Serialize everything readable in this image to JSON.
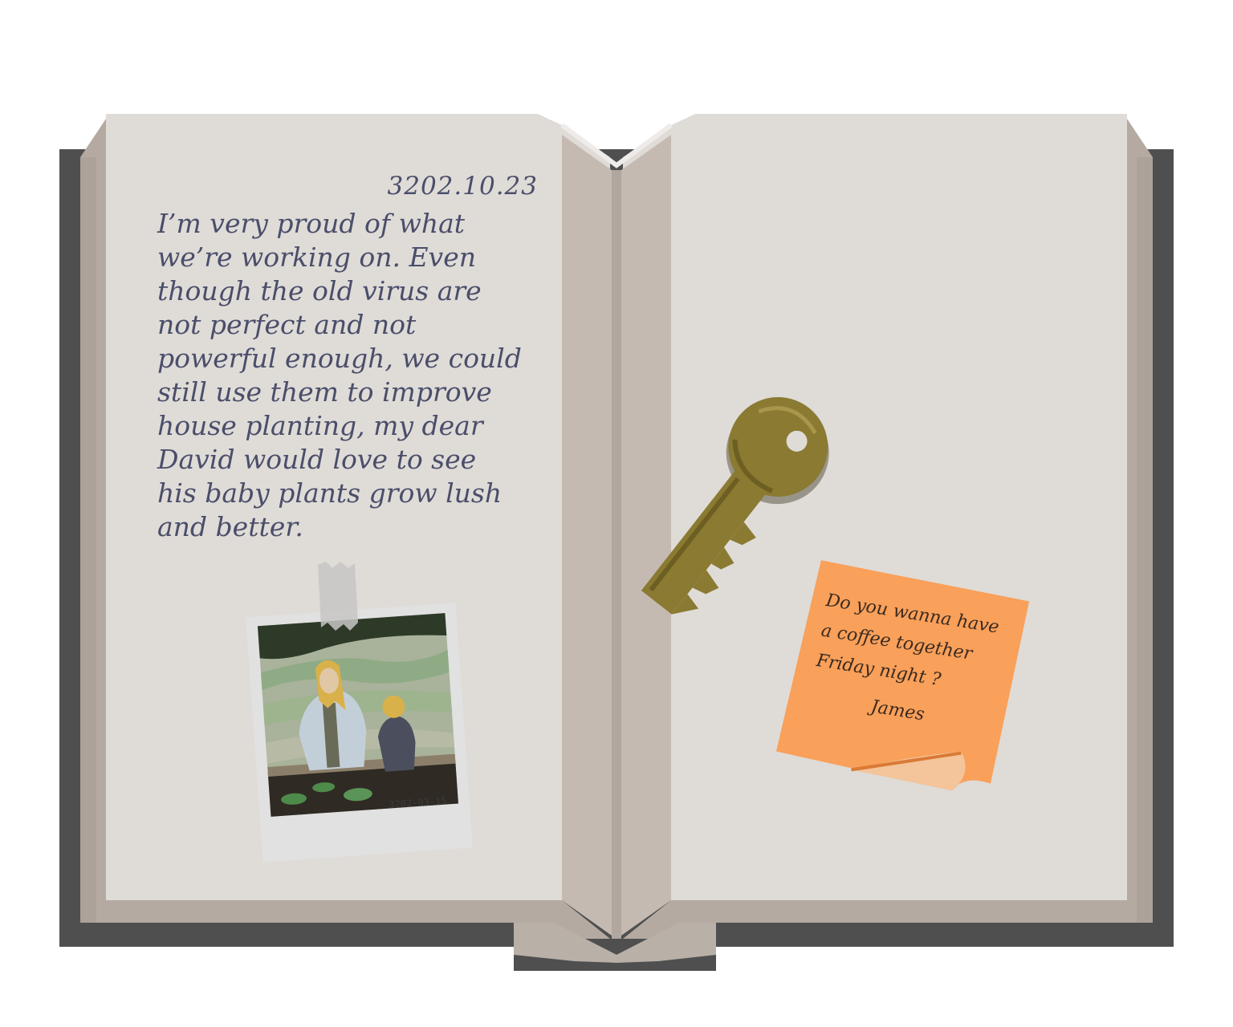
{
  "diary": {
    "date": "3202.10.23",
    "lines": [
      "I’m very proud of what",
      "we’re working on. Even",
      "though the old virus are",
      "not perfect and not",
      "powerful enough, we could",
      "still use them to improve",
      "house planting, my dear",
      "David would love to see",
      "his baby plants grow lush",
      "and better."
    ]
  },
  "photo": {
    "date": "3202-03-15"
  },
  "sticky_note": {
    "lines": [
      "Do you wanna have",
      "a coffee together",
      "Friday night ?"
    ],
    "signature": "James",
    "color": "#f9a05a"
  },
  "key": {
    "icon": "brass-key-icon",
    "color": "#8a7a32"
  },
  "colors": {
    "page": "#dfdbd7",
    "book_edge": "#b6aca4",
    "cover_shadow": "#4f4f4f",
    "ink": "#4a4e6a"
  }
}
